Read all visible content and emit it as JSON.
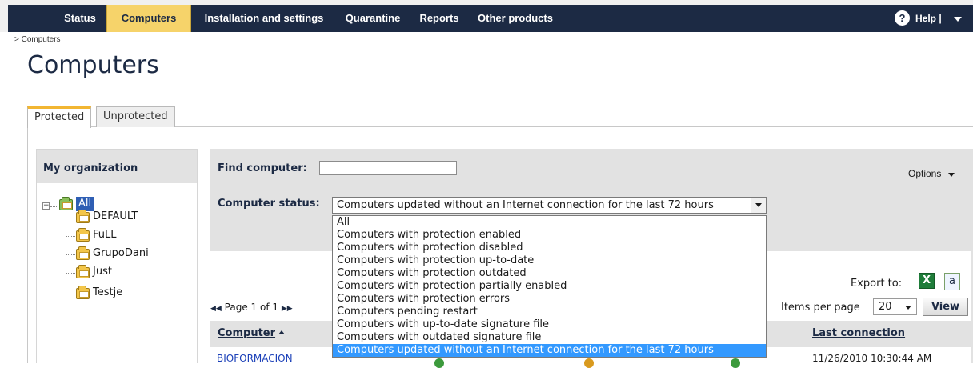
{
  "nav": {
    "items": [
      {
        "label": "Status",
        "active": false
      },
      {
        "label": "Computers",
        "active": true
      },
      {
        "label": "Installation and settings",
        "active": false
      },
      {
        "label": "Quarantine",
        "active": false
      },
      {
        "label": "Reports",
        "active": false
      },
      {
        "label": "Other products",
        "active": false
      }
    ],
    "help_label": "Help |",
    "help_icon": "question-icon"
  },
  "breadcrumb": "> Computers",
  "page_title": "Computers",
  "tabs": [
    {
      "label": "Protected",
      "active": true
    },
    {
      "label": "Unprotected",
      "active": false
    }
  ],
  "organization": {
    "header": "My organization",
    "root": {
      "label": "All",
      "selected": true
    },
    "groups": [
      "DEFAULT",
      "FuLL",
      "GrupoDani",
      "Just",
      "Testje"
    ]
  },
  "filters": {
    "find_label": "Find computer:",
    "find_value": "",
    "options_label": "Options",
    "status_label": "Computer status:",
    "status_selected": "Computers updated without an Internet connection for the last 72 hours",
    "status_options": [
      "All",
      "Computers with protection enabled",
      "Computers with protection disabled",
      "Computers with protection up-to-date",
      "Computers with protection outdated",
      "Computers with protection partially enabled",
      "Computers with protection errors",
      "Computers pending restart",
      "Computers with up-to-date signature file",
      "Computers with outdated signature file",
      "Computers updated without an Internet connection for the last 72 hours"
    ],
    "selected_index": 10
  },
  "export": {
    "label": "Export to:",
    "icons": [
      "excel-icon",
      "text-file-icon"
    ]
  },
  "pager": {
    "text": "Page 1 of 1",
    "items_label": "Items per page",
    "items_value": "20",
    "view_label": "View"
  },
  "table": {
    "columns": [
      "Computer",
      "Last connection"
    ],
    "rows": [
      {
        "computer": "BIOFORMACION",
        "last_connection": "11/26/2010 10:30:44 AM"
      }
    ]
  },
  "colors": {
    "nav_bg": "#1c2a44",
    "nav_active": "#f6d36a",
    "panel_bg": "#e2e2e2",
    "selection": "#3399ff",
    "tree_selection": "#2f5fb4"
  }
}
